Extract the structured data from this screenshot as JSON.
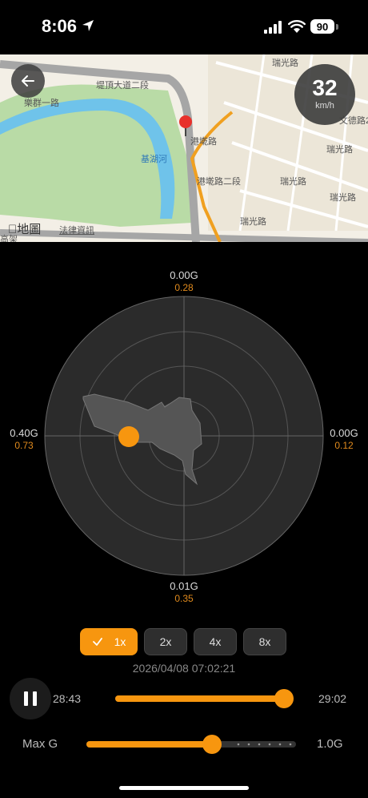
{
  "status": {
    "time": "8:06",
    "battery": "90"
  },
  "map": {
    "speed": "32",
    "speed_unit": "km/h",
    "brand": "地圖",
    "legal": "法律資訊",
    "labels": [
      "堤頂大道二段",
      "樂群一路",
      "港墘路",
      "基湖河",
      "瑞光路",
      "瑞光路",
      "瑞光路",
      "港墘路二段",
      "文德路22巷",
      "瑞光路",
      "瑞光路",
      "高架",
      "5",
      "1"
    ]
  },
  "radar": {
    "top": {
      "g": "0.00G",
      "v": "0.28"
    },
    "left": {
      "g": "0.40G",
      "v": "0.73"
    },
    "right": {
      "g": "0.00G",
      "v": "0.12"
    },
    "bottom": {
      "g": "0.01G",
      "v": "0.35"
    },
    "point_color": "#f7960f"
  },
  "playback": {
    "speeds": [
      "1x",
      "2x",
      "4x",
      "8x"
    ],
    "active_speed": "1x",
    "datetime": "2026/04/08 07:02:21",
    "start": "28:43",
    "end": "29:02",
    "progress": 0.97
  },
  "maxg": {
    "label": "Max G",
    "value": "1.0G",
    "level": 0.6
  },
  "accent": "#f7960f"
}
